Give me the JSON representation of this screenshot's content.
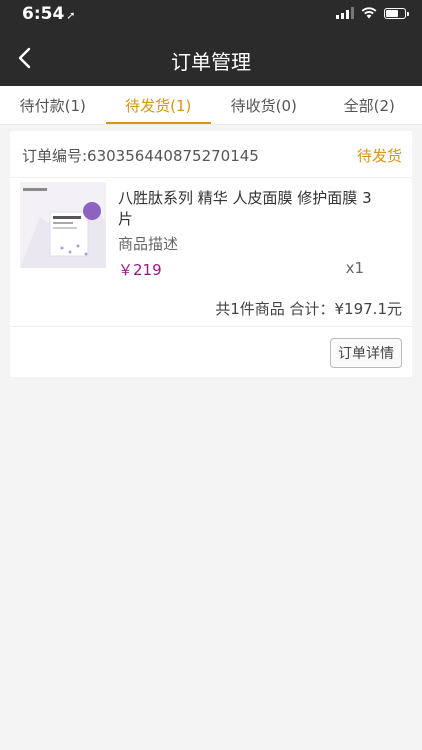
{
  "status_bar": {
    "time": "6:54",
    "location_icon": "location-arrow-icon"
  },
  "header": {
    "title": "订单管理",
    "back_icon": "back-chevron-icon"
  },
  "tabs": [
    {
      "label": "待付款(1)",
      "active": false
    },
    {
      "label": "待发货(1)",
      "active": true
    },
    {
      "label": "待收货(0)",
      "active": false
    },
    {
      "label": "全部(2)",
      "active": false
    }
  ],
  "order": {
    "number_label": "订单编号:630356440875270145",
    "status": "待发货",
    "product": {
      "name": "八胜肽系列 精华 人皮面膜 修护面膜 3片",
      "description": "商品描述",
      "price": "￥219",
      "quantity": "x1"
    },
    "summary": "共1件商品 合计：¥197.1元",
    "detail_button": "订单详情"
  },
  "colors": {
    "accent": "#d99419",
    "price": "#a0177e",
    "topbar": "#2b2b2b"
  }
}
